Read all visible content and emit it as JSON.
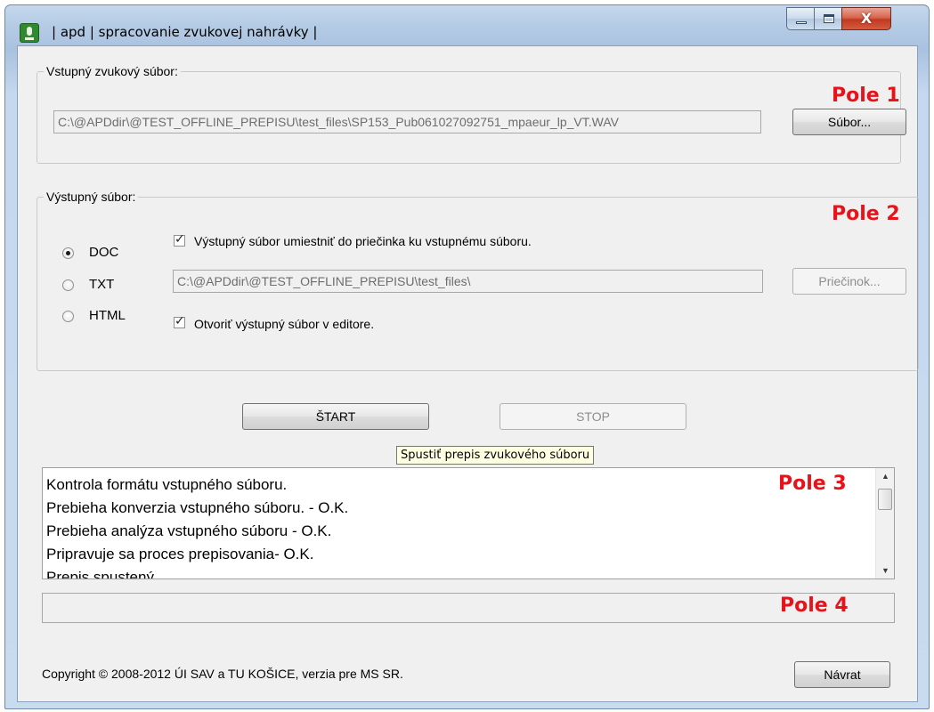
{
  "window": {
    "title": "| apd | spracovanie zvukovej nahrávky |",
    "close_glyph": "X"
  },
  "input_group": {
    "legend": "Vstupný zvukový súbor:",
    "path_value": "C:\\@APDdir\\@TEST_OFFLINE_PREPISU\\test_files\\SP153_Pub061027092751_mpaeur_lp_VT.WAV",
    "browse_button": "Súbor...",
    "annotation": "Pole 1"
  },
  "output_group": {
    "legend": "Výstupný súbor:",
    "annotation": "Pole 2",
    "formats": [
      {
        "label": "DOC",
        "selected": true
      },
      {
        "label": "TXT",
        "selected": false
      },
      {
        "label": "HTML",
        "selected": false
      }
    ],
    "same_folder_checkbox": {
      "label": "Výstupný súbor umiestniť do priečinka ku vstupnému súboru.",
      "checked": true
    },
    "folder_value": "C:\\@APDdir\\@TEST_OFFLINE_PREPISU\\test_files\\",
    "folder_button": "Priečinok...",
    "open_editor_checkbox": {
      "label": "Otvoriť výstupný súbor v editore.",
      "checked": true
    }
  },
  "actions": {
    "start": "ŠTART",
    "stop": "STOP",
    "tooltip": "Spustiť prepis zvukového súboru"
  },
  "log": {
    "annotation": "Pole 3",
    "lines": [
      "Kontrola formátu vstupného súboru.",
      "Prebieha konverzia vstupného súboru. - O.K.",
      "Prebieha analýza vstupného súboru - O.K.",
      "Pripravuje sa proces prepisovania- O.K.",
      "Prepis spustený"
    ]
  },
  "status_bar": {
    "annotation": "Pole 4"
  },
  "footer": {
    "copyright": "Copyright © 2008-2012 ÚI SAV a TU KOŠICE, verzia pre MS SR.",
    "back_button": "Návrat"
  }
}
